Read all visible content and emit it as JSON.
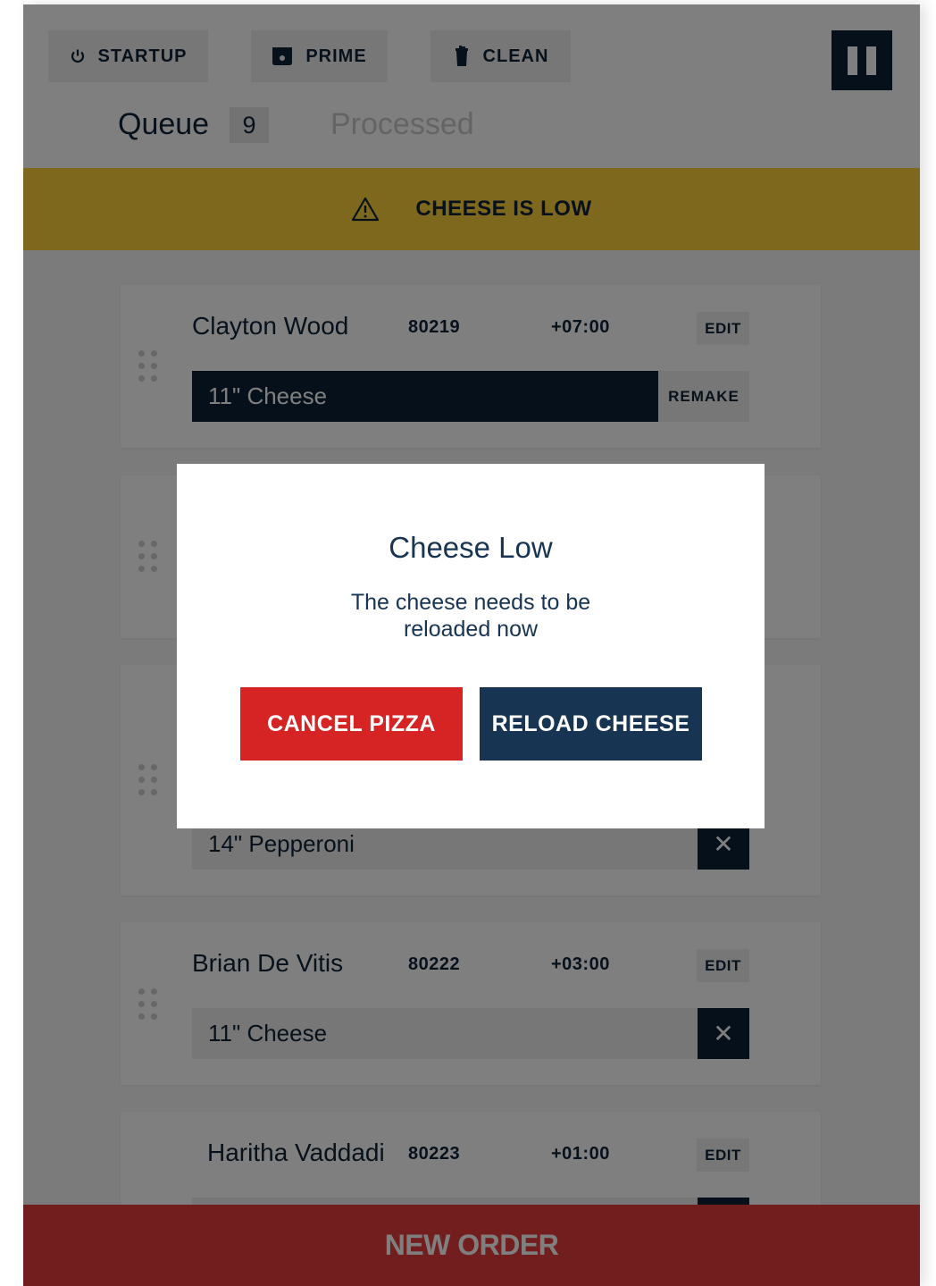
{
  "toolbar": {
    "startup_label": "STARTUP",
    "prime_label": "PRIME",
    "clean_label": "CLEAN",
    "pause_icon": "pause-icon"
  },
  "tabs": {
    "queue_label": "Queue",
    "queue_count": "9",
    "processed_label": "Processed"
  },
  "alert": {
    "icon": "warning-triangle-icon",
    "text": "CHEESE IS LOW"
  },
  "orders": [
    {
      "name": "Clayton Wood",
      "number": "80219",
      "time": "+07:00",
      "edit_label": "EDIT",
      "pizza": "11\"  Cheese",
      "action_label": "REMAKE"
    },
    {
      "pizza": "14\"  Pepperoni",
      "action_label": "✕"
    },
    {
      "name": "Brian De Vitis",
      "number": "80222",
      "time": "+03:00",
      "edit_label": "EDIT",
      "pizza": "11\"  Cheese",
      "action_label": "✕"
    },
    {
      "name": "Haritha Vaddadi",
      "number": "80223",
      "time": "+01:00",
      "edit_label": "EDIT"
    }
  ],
  "footer": {
    "new_order_label": "NEW ORDER"
  },
  "modal": {
    "title": "Cheese Low",
    "message": "The cheese needs to be reloaded now",
    "cancel_label": "CANCEL PIZZA",
    "reload_label": "RELOAD CHEESE"
  },
  "colors": {
    "navy": "#0c2134",
    "alert_yellow": "#fbd13d",
    "danger_red": "#d62424",
    "new_order_red": "#e63c3c",
    "modal_navy": "#173452"
  }
}
